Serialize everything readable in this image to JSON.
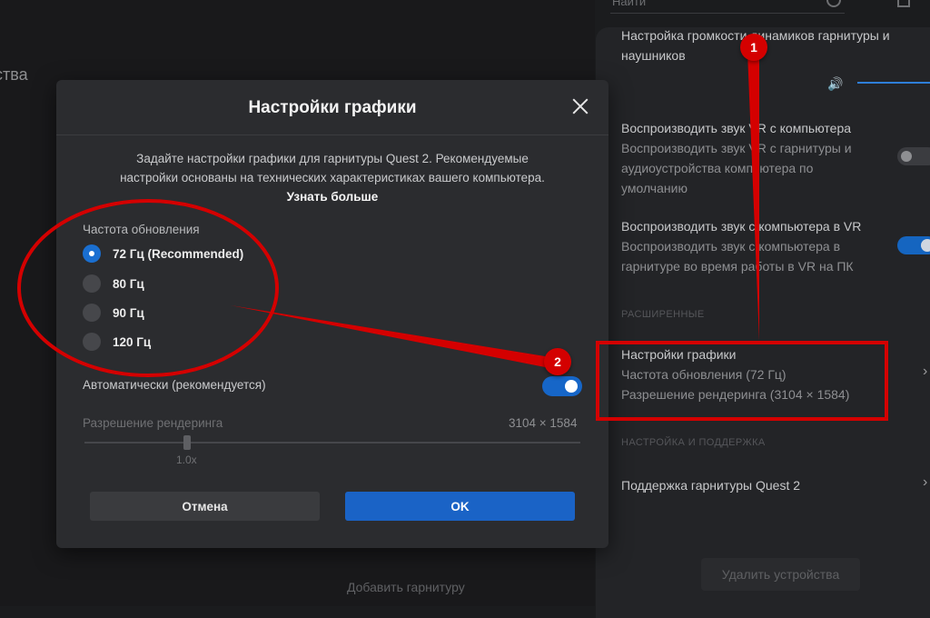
{
  "background": {
    "partial_title": "ства",
    "search_placeholder": "Найти",
    "add_headset": "Добавить гарнитуру"
  },
  "panel": {
    "volume_title": "Настройка громкости динамиков гарнитуры и наушников",
    "play_pc_title": "Воспроизводить звук VR с компьютера",
    "play_pc_desc": "Воспроизводить звук VR с гарнитуры и аудиоустройства компьютера по умолчанию",
    "play_vr_title": "Воспроизводить звук с компьютера в VR",
    "play_vr_desc": "Воспроизводить звук с компьютера в гарнитуре во время работы в VR на ПК",
    "section_advanced": "РАСШИРЕННЫЕ",
    "graphics_title": "Настройки графики",
    "graphics_refresh": "Частота обновления (72 Гц)",
    "graphics_resolution": "Разрешение рендеринга (3104 × 1584)",
    "section_support": "НАСТРОЙКА И ПОДДЕРЖКА",
    "support_item": "Поддержка гарнитуры Quest 2",
    "remove_devices": "Удалить устройства"
  },
  "dialog": {
    "title": "Настройки графики",
    "description": "Задайте настройки графики для гарнитуры Quest 2. Рекомендуемые настройки основаны на технических характеристиках вашего компьютера.",
    "learn_more": "Узнать больше",
    "refresh_label": "Частота обновления",
    "refresh_options": [
      "72 Гц (Recommended)",
      "80 Гц",
      "90 Гц",
      "120 Гц"
    ],
    "selected_index": 0,
    "auto_label": "Автоматически (рекомендуется)",
    "auto_enabled": true,
    "resolution_label": "Разрешение рендеринга",
    "resolution_value": "3104 × 1584",
    "slider_mark": "1.0x",
    "cancel": "Отмена",
    "ok": "OK"
  },
  "annotations": {
    "badge1": "1",
    "badge2": "2",
    "color": "#d40000"
  }
}
